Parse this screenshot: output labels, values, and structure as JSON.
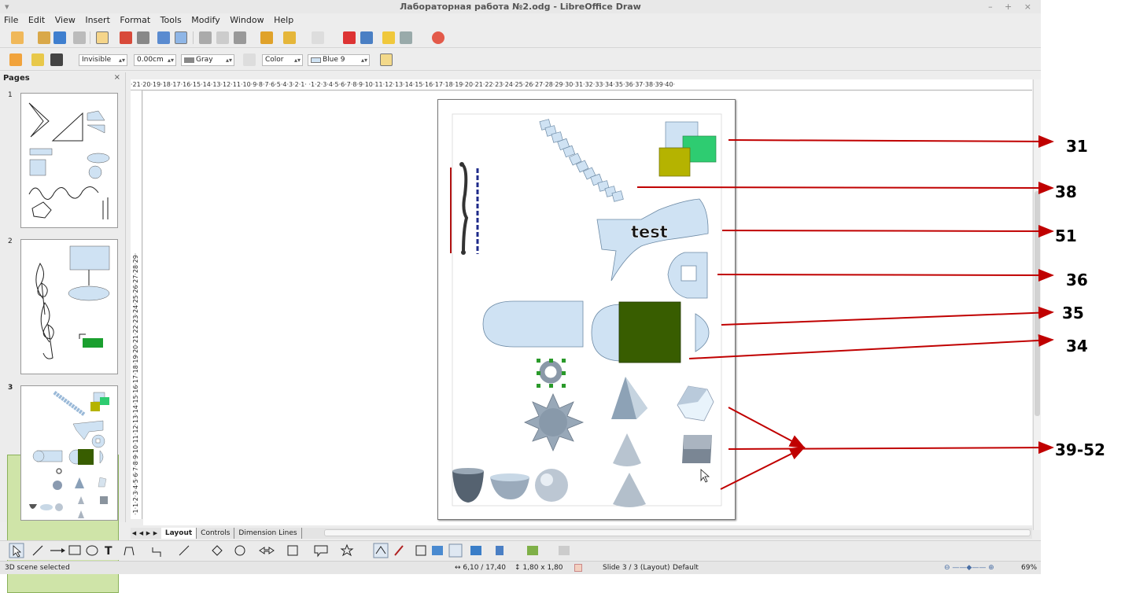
{
  "window": {
    "title": "Лабораторная работа №2.odg - LibreOffice Draw",
    "controls": "– + ×",
    "sysmenu": "▾"
  },
  "menu": [
    "File",
    "Edit",
    "View",
    "Insert",
    "Format",
    "Tools",
    "Modify",
    "Window",
    "Help"
  ],
  "line_props": {
    "line_style": "Invisible",
    "line_width": "0.00cm",
    "line_color": "Gray",
    "area_style": "Color",
    "area_color": "Blue 9"
  },
  "pages_panel": {
    "title": "Pages",
    "close": "×",
    "page_numbers": [
      "1",
      "2",
      "3"
    ],
    "selected": "3"
  },
  "ruler_h_text": "·21·20·19·18·17·16·15·14·13·12·11·10·9·8·7·6·5·4·3·2·1· ·1·2·3·4·5·6·7·8·9·10·11·12·13·14·15·16·17·18·19·20·21·22·23·24·25·26·27·28·29·30·31·32·33·34·35·36·37·38·39·40·",
  "ruler_v_text": "·1·1·2·3·4·5·6·7·8·9·10·11·12·13·14·15·16·17·18·19·20·21·22·23·24·25·26·27·28·29·",
  "tabs": {
    "items": [
      "Layout",
      "Controls",
      "Dimension Lines"
    ],
    "active": "Layout"
  },
  "status": {
    "selection": "3D scene selected",
    "position": "6,10 / 17,40",
    "size": "1,80 x 1,80",
    "slide": "Slide 3 / 3 (Layout)",
    "master": "Default",
    "zoom": "69%"
  },
  "slide_text": "test",
  "annotations": [
    "31",
    "38",
    "51",
    "36",
    "35",
    "34",
    "39-52"
  ],
  "colors": {
    "accent_arrow": "#c00000",
    "shape_fill": "#cfe2f3",
    "dark_green": "#385d00",
    "green": "#2ecc71",
    "olive": "#b5b300"
  }
}
